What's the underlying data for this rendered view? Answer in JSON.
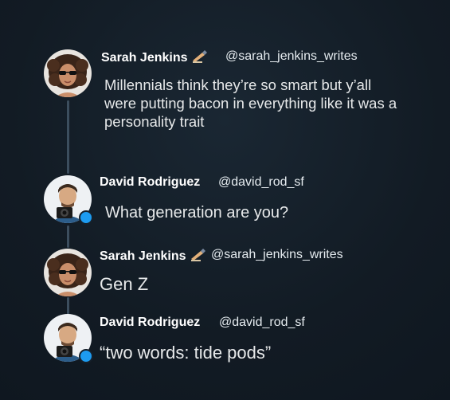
{
  "colors": {
    "background": "#15202b",
    "thread_line": "#3c4e5e",
    "badge": "#1d9bf0",
    "text": "#e7e9ea"
  },
  "tweets": [
    {
      "name": "Sarah Jenkins",
      "name_emoji": "writing-hand-icon",
      "handle": "@sarah_jenkins_writes",
      "text": "Millennials think they’re so smart but y’all were putting bacon in everything like it was a personality trait"
    },
    {
      "name": "David Rodriguez",
      "handle": "@david_rod_sf",
      "text": "What generation are you?"
    },
    {
      "name": "Sarah Jenkins",
      "name_emoji": "writing-hand-icon",
      "handle": "@sarah_jenkins_writes",
      "text": "Gen Z"
    },
    {
      "name": "David Rodriguez",
      "handle": "@david_rod_sf",
      "text": "“two words: tide pods”"
    }
  ]
}
